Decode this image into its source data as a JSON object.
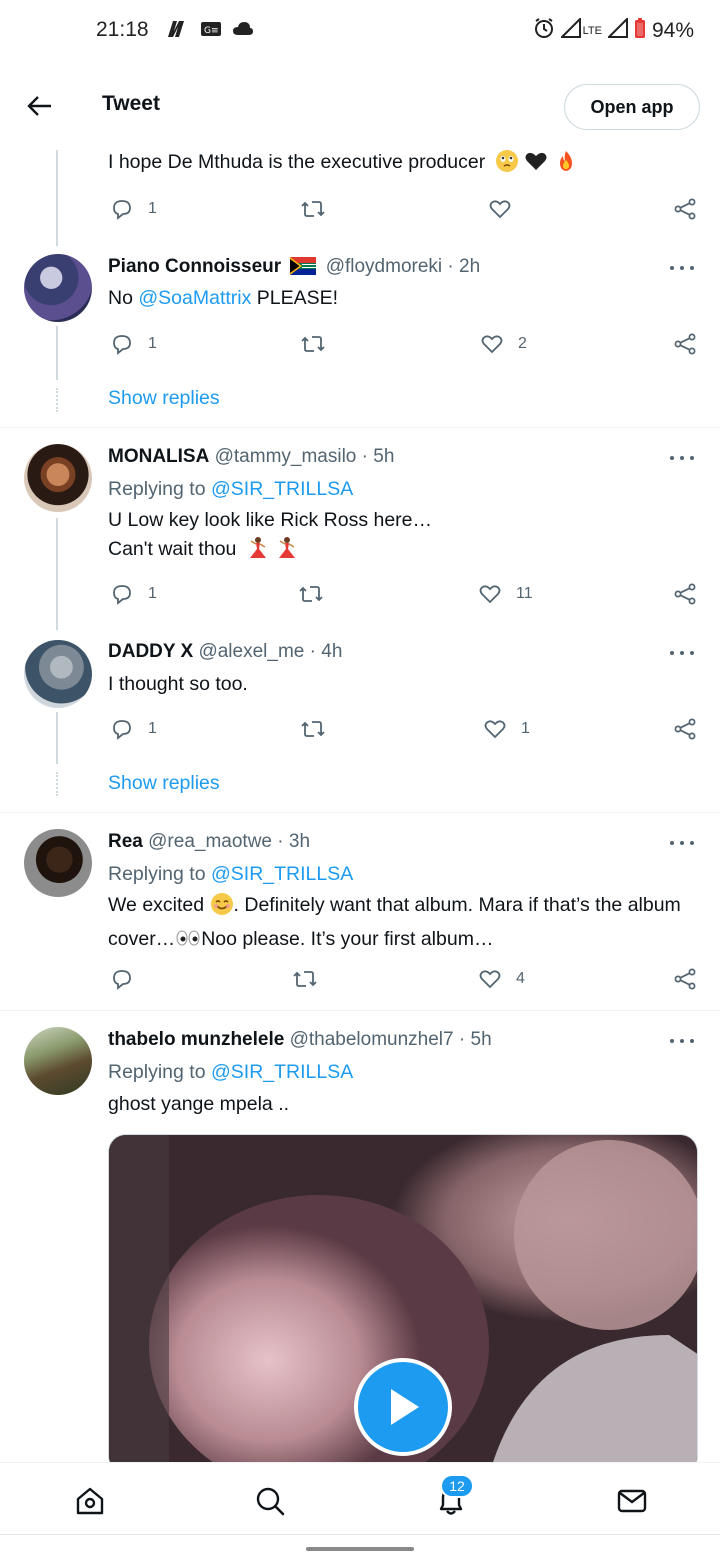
{
  "status_bar": {
    "time": "21:18",
    "network": "LTE",
    "battery": "94%",
    "icons": [
      "netflix-icon",
      "news-icon",
      "cloud-icon",
      "alarm-icon",
      "signal-icon",
      "battery-icon"
    ]
  },
  "header": {
    "title": "Tweet",
    "open_app_label": "Open app"
  },
  "tweets": [
    {
      "text": "I hope De Mthuda is the executive producer",
      "emojis": [
        "face-emoji",
        "black-heart-emoji",
        "fire-emoji"
      ],
      "reply_count": "1",
      "retweet_count": "",
      "like_count": ""
    },
    {
      "name": "Piano Connoisseur",
      "flag": "south-africa-flag",
      "handle": "@floydmoreki",
      "time": "2h",
      "text_prefix": "No ",
      "mention": "@SoaMattrix",
      "text_suffix": " PLEASE!",
      "reply_count": "1",
      "like_count": "2",
      "show_replies": "Show replies"
    },
    {
      "name": "MONALISA",
      "handle": "@tammy_masilo",
      "time": "5h",
      "replying_label": "Replying to ",
      "replying_to": "@SIR_TRILLSA",
      "text_line1": "U Low key  look like Rick Ross here…",
      "text_line2": "Can't wait thou",
      "emojis": [
        "dancer-emoji",
        "dancer-emoji"
      ],
      "reply_count": "1",
      "like_count": "11"
    },
    {
      "name": "DADDY X",
      "handle": "@alexel_me",
      "time": "4h",
      "text": "I thought so too.",
      "reply_count": "1",
      "like_count": "1",
      "show_replies": "Show replies"
    },
    {
      "name": "Rea",
      "handle": "@rea_maotwe",
      "time": "3h",
      "replying_label": "Replying to ",
      "replying_to": "@SIR_TRILLSA",
      "text_part1": "We excited ",
      "text_part2": ". Definitely want that album. Mara if that’s the album cover…",
      "text_part3": "Noo please. It’s your first album…",
      "like_count": "4"
    },
    {
      "name": "thabelo munzhelele",
      "handle": "@thabelomunzhel7",
      "time": "5h",
      "replying_label": "Replying to ",
      "replying_to": "@SIR_TRILLSA",
      "text": "ghost yange mpela .."
    }
  ],
  "time_separator": " · ",
  "bottom_nav": {
    "notifications_badge": "12",
    "items": [
      "home-icon",
      "search-icon",
      "notifications-icon",
      "messages-icon"
    ]
  },
  "colors": {
    "accent": "#1d9bf0",
    "secondary_text": "#536471",
    "divider": "#eff3f4"
  }
}
